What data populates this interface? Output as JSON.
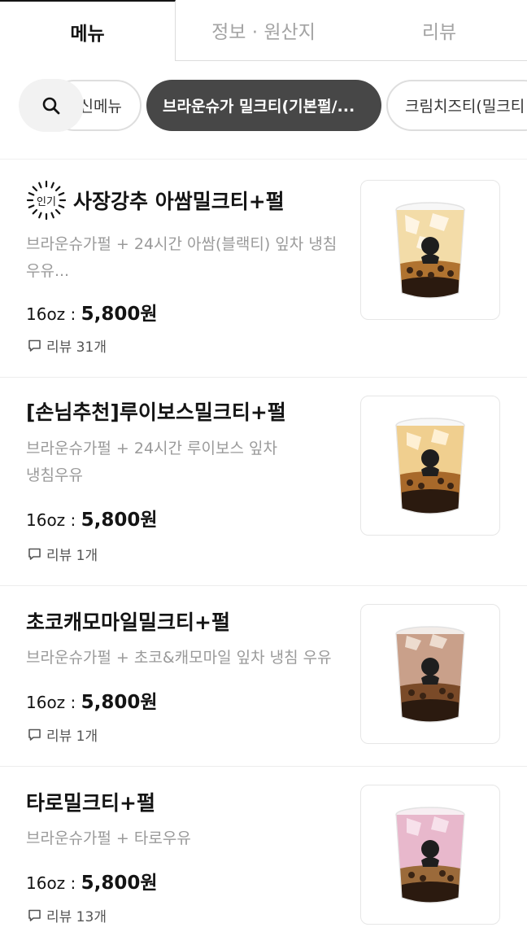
{
  "tabs": [
    {
      "label": "메뉴"
    },
    {
      "label": "정보 · 원산지"
    },
    {
      "label": "리뷰"
    }
  ],
  "search": {
    "icon": "search-icon"
  },
  "categories": [
    {
      "label": "신메뉴"
    },
    {
      "label": "브라운슈가 밀크티(기본펄/..."
    },
    {
      "label": "크림치즈티(밀크티"
    }
  ],
  "menu": [
    {
      "badge": "인기",
      "name": "사장강추 아쌈밀크티+펄",
      "desc_line1": "브라운슈가펄 + 24시간 아쌈(블랙티) 잎차 냉침",
      "desc_line2": "우유...",
      "size": "16oz : ",
      "price": "5,800원",
      "review": "리뷰 31개",
      "tea_color": "#f3dca8"
    },
    {
      "name": "[손님추천]루이보스밀크티+펄",
      "desc_line1": "브라운슈가펄 +  24시간 루이보스 잎차",
      "desc_line2": "냉침우유",
      "size": "16oz : ",
      "price": "5,800원",
      "review": "리뷰 1개",
      "tea_color": "#f0cf8f"
    },
    {
      "name": "초코캐모마일밀크티+펄",
      "desc_line1": "브라운슈가펄 + 초코&캐모마일 잎차 냉침 우유",
      "size": "16oz : ",
      "price": "5,800원",
      "review": "리뷰 1개",
      "tea_color": "#c9a08a"
    },
    {
      "name": "타로밀크티+펄",
      "desc_line1": "브라운슈가펄 +  타로우유",
      "size": "16oz : ",
      "price": "5,800원",
      "review": "리뷰 13개",
      "tea_color": "#e8b8cc"
    }
  ]
}
